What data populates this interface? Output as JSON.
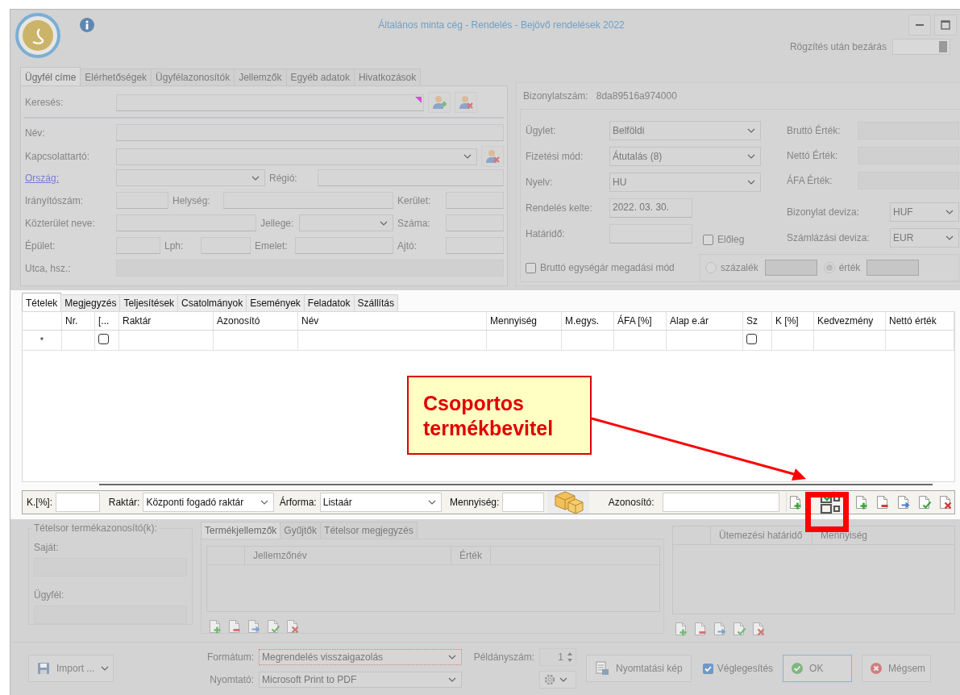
{
  "window": {
    "title": "Általános minta cég - Rendelés - Bejövő rendelések 2022"
  },
  "close_after_save": {
    "label": "Rögzítés után bezárás",
    "on": true
  },
  "customer_tabs": [
    {
      "label": "Ügyfél címe",
      "selected": true
    },
    {
      "label": "Elérhetőségek",
      "selected": false
    },
    {
      "label": "Ügyfélazonosítók",
      "selected": false
    },
    {
      "label": "Jellemzők",
      "selected": false
    },
    {
      "label": "Egyéb adatok",
      "selected": false
    },
    {
      "label": "Hivatkozások",
      "selected": false
    }
  ],
  "customer_form": {
    "search": "Keresés:",
    "name": "Név:",
    "contact": "Kapcsolattartó:",
    "country": "Ország:",
    "region": "Régió:",
    "zip": "Irányítószám:",
    "city": "Helység:",
    "district": "Kerület:",
    "street": "Közterület neve:",
    "street_type": "Jellege:",
    "house_number": "Száma:",
    "building": "Épület:",
    "staircase": "Lph:",
    "floor": "Emelet:",
    "door": "Ajtó:",
    "address": "Utca, hsz.:"
  },
  "document": {
    "number_label": "Bizonylatszám:",
    "number": "8da89516a974000",
    "fields": [
      {
        "label": "Ügylet:",
        "value": "Belföldi",
        "kind": "combo"
      },
      {
        "label": "Fizetési mód:",
        "value": "Átutalás (8)",
        "kind": "combo"
      },
      {
        "label": "Nyelv:",
        "value": "HU",
        "kind": "combo"
      },
      {
        "label": "Rendelés kelte:",
        "value": "2022. 03. 30.",
        "kind": "date"
      },
      {
        "label": "Határidő:",
        "kind": "date"
      }
    ],
    "totals": [
      {
        "label": "Bruttó Érték:"
      },
      {
        "label": "Nettó Érték:"
      },
      {
        "label": "ÁFA Érték:"
      }
    ],
    "currencies": [
      {
        "label": "Bizonylat deviza:",
        "value": "HUF"
      },
      {
        "label": "Számlázási deviza:",
        "value": "EUR"
      }
    ],
    "advance": {
      "label": "Előleg",
      "checked": false
    },
    "gross_price_mode": {
      "label": "Bruttó egységár megadási mód",
      "checked": false
    },
    "advance_modes": [
      {
        "label": "százalék",
        "selected": false
      },
      {
        "label": "érték",
        "selected": true
      }
    ]
  },
  "item_tabs": [
    {
      "label": "Tételek",
      "selected": true
    },
    {
      "label": "Megjegyzés",
      "selected": false
    },
    {
      "label": "Teljesítések",
      "selected": false
    },
    {
      "label": "Csatolmányok",
      "selected": false
    },
    {
      "label": "Események",
      "selected": false
    },
    {
      "label": "Feladatok",
      "selected": false
    },
    {
      "label": "Szállítás",
      "selected": false
    }
  ],
  "items_table": {
    "columns": [
      "Nr.",
      "[...",
      "Raktár",
      "Azonosító",
      "Név",
      "Mennyiség",
      "M.egys.",
      "ÁFA [%]",
      "Alap e.ár",
      "Sz",
      "K [%]",
      "Kedvezmény",
      "Nettó érték"
    ],
    "new_row": {
      "marker": "*",
      "cells": [
        {
          "kind": "blank"
        },
        {
          "kind": "check",
          "checked": false
        },
        {
          "kind": "blank"
        },
        {
          "kind": "blank"
        },
        {
          "kind": "blank"
        },
        {
          "kind": "blank"
        },
        {
          "kind": "blank"
        },
        {
          "kind": "blank"
        },
        {
          "kind": "blank"
        },
        {
          "kind": "check",
          "checked": false
        },
        {
          "kind": "blank"
        },
        {
          "kind": "blank"
        },
        {
          "kind": "blank"
        }
      ]
    }
  },
  "entry_bar": {
    "discount_label": "K.[%]:",
    "warehouse_label": "Raktár:",
    "warehouse": "Központi fogadó raktár",
    "price_form_label": "Árforma:",
    "price_form": "Listaár",
    "quantity_label": "Mennyiség:",
    "code_label": "Azonosító:"
  },
  "callout": {
    "text": "Csoportos termékbevitel"
  },
  "item_codes": {
    "title": "Tételsor termékazonosító(k):",
    "own": "Saját:",
    "customer": "Ügyfél:"
  },
  "detail_tabs": [
    {
      "label": "Termékjellemzők",
      "selected": true
    },
    {
      "label": "Gyűjtők",
      "selected": false
    },
    {
      "label": "Tételsor megjegyzés",
      "selected": false
    }
  ],
  "property_columns": [
    "Jellemzőnév",
    "Érték"
  ],
  "schedule_columns": [
    "Ütemezési határidő",
    "Mennyiség"
  ],
  "footer": {
    "import": "Import ...",
    "format_label": "Formátum:",
    "format": "Megrendelés visszaigazolás",
    "printer_label": "Nyomtató:",
    "printer": "Microsoft Print to PDF",
    "copies_label": "Példányszám:",
    "copies": "1",
    "preview": "Nyomtatási kép",
    "finalize": {
      "label": "Véglegesítés",
      "checked": true
    },
    "ok": "OK",
    "cancel": "Mégsem"
  }
}
